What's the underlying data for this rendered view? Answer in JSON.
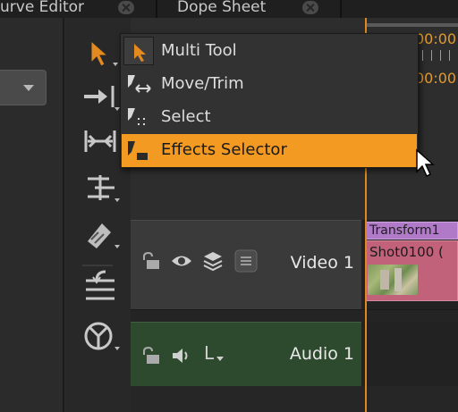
{
  "tabs": [
    {
      "label": "urve Editor",
      "close_label": "close"
    },
    {
      "label": "Dope Sheet",
      "close_label": "close"
    }
  ],
  "timeline": {
    "timecode_top": "00:00",
    "timecode_second": "00:00"
  },
  "tool_menu": {
    "items": [
      {
        "label": "Multi Tool",
        "icon": "arrow-pointer-icon",
        "state": "current"
      },
      {
        "label": "Move/Trim",
        "icon": "move-trim-icon",
        "state": "normal"
      },
      {
        "label": "Select",
        "icon": "select-icon",
        "state": "normal"
      },
      {
        "label": "Effects Selector",
        "icon": "effects-selector-icon",
        "state": "highlighted"
      }
    ]
  },
  "tracks": {
    "video": {
      "label": "Video 1"
    },
    "audio": {
      "label": "Audio 1",
      "channel_label": "L"
    }
  },
  "clips": {
    "effect_label": "Transform1",
    "shot_label": "Shot0100 ("
  },
  "colors": {
    "accent": "#f39a22",
    "playhead": "#e0881f",
    "effect_clip": "#b07ac8",
    "shot_clip": "#c2627a",
    "audio_track": "#2e4a2e"
  }
}
